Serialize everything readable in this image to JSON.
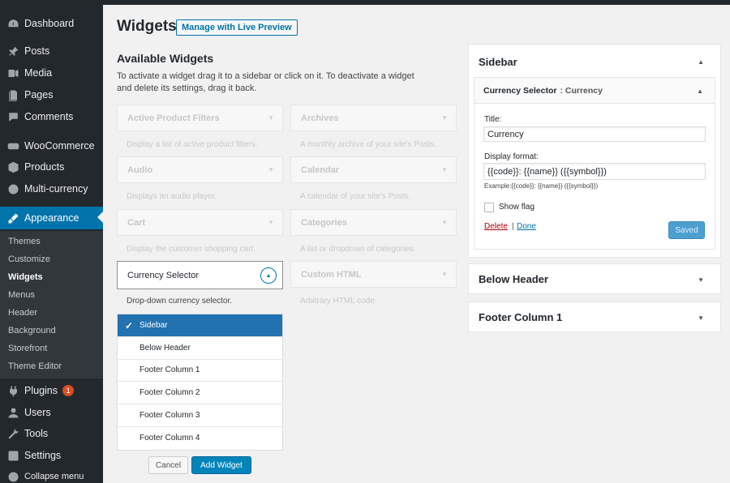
{
  "sidebar": {
    "menu": [
      {
        "label": "Dashboard",
        "icon": "dashboard-icon"
      },
      {
        "label": "Posts",
        "icon": "pin-icon"
      },
      {
        "label": "Media",
        "icon": "media-icon"
      },
      {
        "label": "Pages",
        "icon": "pages-icon"
      },
      {
        "label": "Comments",
        "icon": "comments-icon"
      },
      {
        "label": "WooCommerce",
        "icon": "woocommerce-icon"
      },
      {
        "label": "Products",
        "icon": "products-icon"
      },
      {
        "label": "Multi-currency",
        "icon": "globe-icon"
      },
      {
        "label": "Appearance",
        "icon": "brush-icon"
      }
    ],
    "submenu": [
      "Themes",
      "Customize",
      "Widgets",
      "Menus",
      "Header",
      "Background",
      "Storefront",
      "Theme Editor"
    ],
    "lower": [
      {
        "label": "Plugins",
        "icon": "plugin-icon",
        "badge": "1"
      },
      {
        "label": "Users",
        "icon": "users-icon"
      },
      {
        "label": "Tools",
        "icon": "wrench-icon"
      },
      {
        "label": "Settings",
        "icon": "settings-icon"
      },
      {
        "label": "Collapse menu",
        "icon": "collapse-icon"
      }
    ]
  },
  "header": {
    "title": "Widgets",
    "live_preview": "Manage with Live Preview"
  },
  "available": {
    "title": "Available Widgets",
    "description": "To activate a widget drag it to a sidebar or click on it. To deactivate a widget and delete its settings, drag it back.",
    "widgets": [
      {
        "name": "Active Product Filters",
        "desc": "Display a list of active product filters."
      },
      {
        "name": "Archives",
        "desc": "A monthly archive of your site's Posts."
      },
      {
        "name": "Audio",
        "desc": "Displays an audio player."
      },
      {
        "name": "Calendar",
        "desc": "A calendar of your site's Posts."
      },
      {
        "name": "Cart",
        "desc": "Display the customer shopping cart."
      },
      {
        "name": "Categories",
        "desc": "A list or dropdown of categories."
      },
      {
        "name": "Custom HTML",
        "desc": "Arbitrary HTML code."
      }
    ],
    "selected_widget": {
      "name": "Currency Selector",
      "desc": "Drop-down currency selector."
    },
    "chooser": [
      "Sidebar",
      "Below Header",
      "Footer Column 1",
      "Footer Column 2",
      "Footer Column 3",
      "Footer Column 4"
    ],
    "cancel": "Cancel",
    "add": "Add Widget"
  },
  "areas": {
    "sidebar": {
      "title": "Sidebar",
      "widget": {
        "name": "Currency Selector",
        "instance_title": ": Currency",
        "title_label": "Title:",
        "title_value": "Currency",
        "format_label": "Display format:",
        "format_value": "{{code}}: {{name}} ({{symbol}})",
        "example": "Example:{{code}}: {{name}} ({{symbol}})",
        "show_flag": "Show flag",
        "delete": "Delete",
        "separator": "|",
        "done": "Done",
        "saved": "Saved"
      }
    },
    "below_header": {
      "title": "Below Header"
    },
    "footer_column_1": {
      "title": "Footer Column 1"
    }
  },
  "colors": {
    "sidebar_bg": "#23282d",
    "accent": "#0073aa",
    "chooser_selected": "#2271b1",
    "badge": "#d54e21",
    "delete": "#aa0000"
  }
}
